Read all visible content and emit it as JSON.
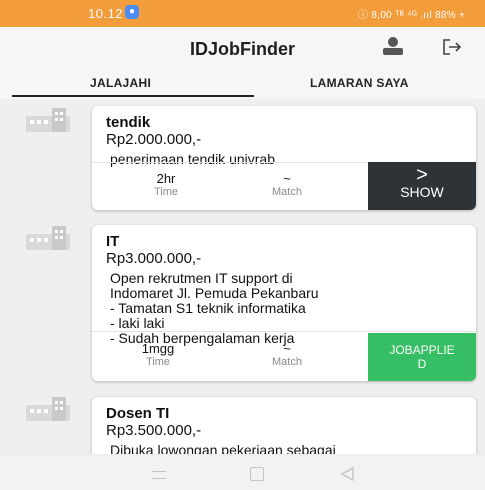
{
  "status_bar": {
    "time": "10.12",
    "right_text": "ⓘ 8,00 ᵀᴮ ⁴ᴳ .ııl 88% +",
    "color": "#f39c3b"
  },
  "app_bar": {
    "title": "IDJobFinder",
    "icons": [
      "person-icon",
      "logout-icon"
    ]
  },
  "tabs": [
    {
      "label": "JALAJAHI",
      "active": true
    },
    {
      "label": "LAMARAN SAYA",
      "active": false
    }
  ],
  "jobs": [
    {
      "title": "tendik",
      "salary": "Rp2.000.000,-",
      "description": "penerimaan tendik univrab",
      "time": "2hr",
      "time_label": "Time",
      "match": "~",
      "match_label": "Match",
      "action_symbol": ">",
      "action_label": "SHOW"
    },
    {
      "title": "IT",
      "salary": "Rp3.000.000,-",
      "description": "Open rekrutmen IT support di\nIndomaret Jl. Pemuda Pekanbaru\n- Tamatan S1 teknik informatika\n- laki laki\n- Sudah berpengalaman kerja",
      "time": "1mgg",
      "time_label": "Time",
      "match": "~",
      "match_label": "Match",
      "action_label": "JOBAPPLIE\nD"
    },
    {
      "title": "Dosen TI",
      "salary": "Rp3.500.000,-",
      "description": "Dibuka lowongan pekerjaan sebagai\nDosen TI di universitas Abdurrab\nsyaratnya"
    }
  ],
  "colors": {
    "show_button": "#2e3338",
    "applied_button": "#35be63"
  }
}
